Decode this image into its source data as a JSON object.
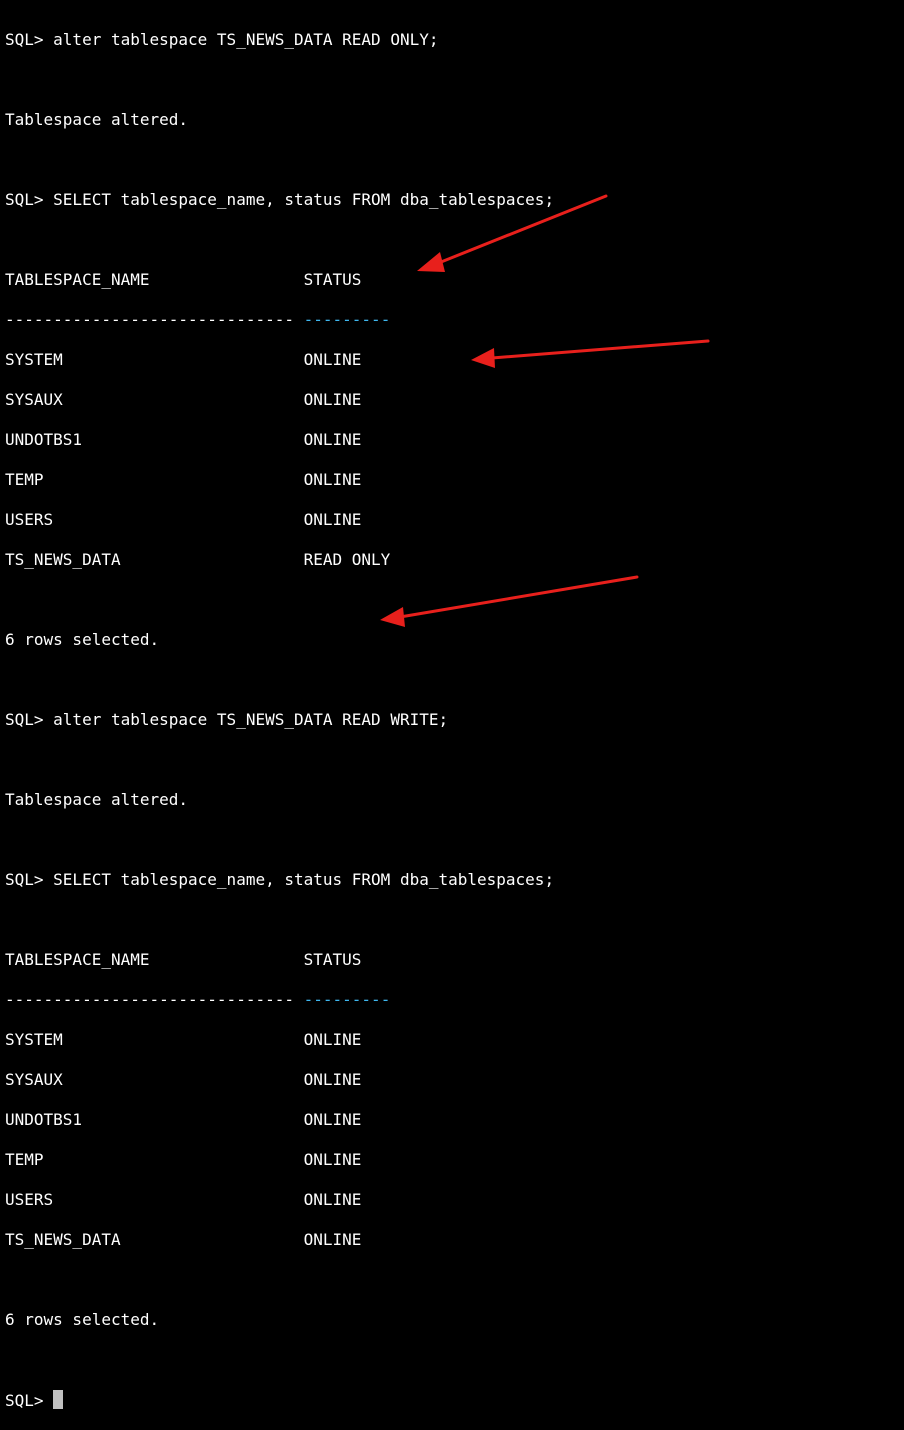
{
  "colors": {
    "background": "#000000",
    "text": "#ffffff",
    "dash_accent": "#3fb8f0",
    "cursor": "#c0c0c0",
    "arrow": "#e8201c"
  },
  "session": {
    "cmd1": "SQL> alter tablespace TS_NEWS_DATA READ ONLY;",
    "result1": "Tablespace altered.",
    "query1": "SQL> SELECT tablespace_name, status FROM dba_tablespaces;",
    "table1": {
      "header": "TABLESPACE_NAME                STATUS",
      "dash_name": "------------------------------ ",
      "dash_status": "---------",
      "rows": [
        "SYSTEM                         ONLINE",
        "SYSAUX                         ONLINE",
        "UNDOTBS1                       ONLINE",
        "TEMP                           ONLINE",
        "USERS                          ONLINE",
        "TS_NEWS_DATA                   READ ONLY"
      ]
    },
    "rows_selected1": "6 rows selected.",
    "cmd2": "SQL> alter tablespace TS_NEWS_DATA READ WRITE;",
    "result2": "Tablespace altered.",
    "query2": "SQL> SELECT tablespace_name, status FROM dba_tablespaces;",
    "table2": {
      "header": "TABLESPACE_NAME                STATUS",
      "dash_name": "------------------------------ ",
      "dash_status": "---------",
      "rows": [
        "SYSTEM                         ONLINE",
        "SYSAUX                         ONLINE",
        "UNDOTBS1                       ONLINE",
        "TEMP                           ONLINE",
        "USERS                          ONLINE",
        "TS_NEWS_DATA                   ONLINE"
      ]
    },
    "rows_selected2": "6 rows selected.",
    "prompt": "SQL> "
  }
}
